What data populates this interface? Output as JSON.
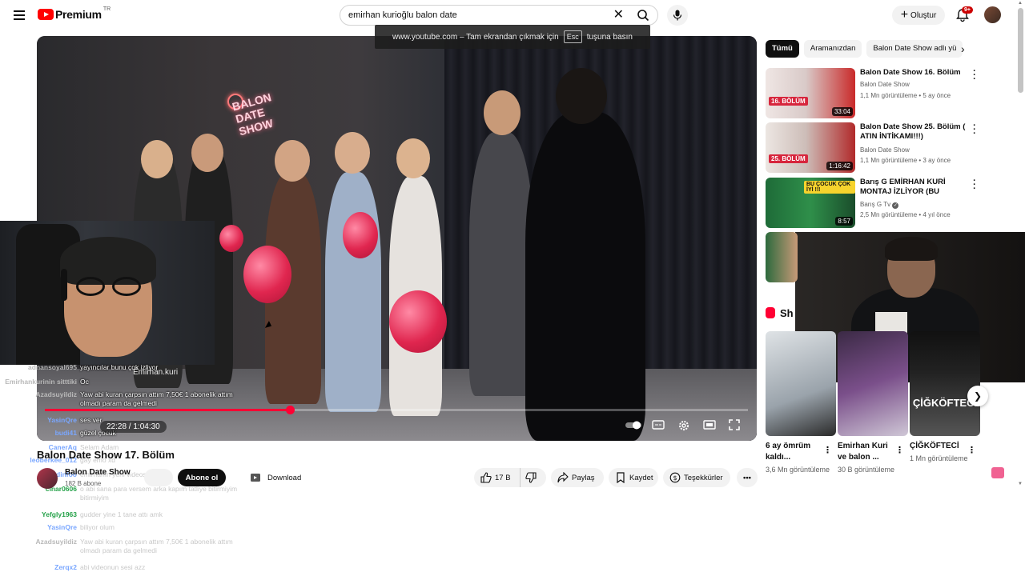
{
  "header": {
    "logo_text": "Premium",
    "logo_region": "TR",
    "search_value": "emirhan kurioğlu balon date",
    "create_label": "Oluştur",
    "notification_count": "9+"
  },
  "fullscreen_tooltip": {
    "text_before": "www.youtube.com – Tam ekrandan çıkmak için",
    "key": "Esc",
    "text_after": "tuşuna basın"
  },
  "player": {
    "current_time": "22:28",
    "duration": "1:04:30",
    "time_separator": " / ",
    "progress_fraction": 0.348,
    "watermark": "Emirhan.kuri",
    "neon_sign": "BALON DATE SHOW"
  },
  "video": {
    "title": "Balon Date Show 17. Bölüm",
    "channel": "Balon Date Show",
    "subscribers": "182 B abone",
    "subscribe_label": "Abone ol",
    "download_label": "Download",
    "likes": "17 B",
    "share_label": "Paylaş",
    "save_label": "Kaydet",
    "thanks_label": "Teşekkürler"
  },
  "chat": [
    {
      "user": "adnansoyal695",
      "msg": "yayıncılar bunu çok izliyor",
      "color": "#b9b9b9",
      "faded": false
    },
    {
      "user": "Emirhankurinin sitttiki",
      "msg": "Oc",
      "color": "#b9b9b9",
      "faded": false
    },
    {
      "user": "Azadsuyildiz",
      "msg": "Yaw abi kuran çarpsın attım 7,50€ 1 abonelik attım olmadı param da gelmedi",
      "color": "#b9b9b9",
      "faded": false
    },
    {
      "user": "YasinQre",
      "msg": "ses ver",
      "color": "#7aa7ff",
      "faded": false
    },
    {
      "user": "budi41",
      "msg": "güzel çocuk",
      "color": "#7aa7ff",
      "faded": false
    },
    {
      "user": "CanerAq",
      "msg": "Selam Adam",
      "color": "#7aa7ff",
      "faded": true
    },
    {
      "user": "leoberkee_012",
      "msg": "gay emo xd",
      "color": "#7aa7ff",
      "faded": true
    },
    {
      "user": "Bedinfoo",
      "msg": "emirhanın yeni videosu izlendi",
      "color": "#7aa7ff",
      "faded": true
    },
    {
      "user": "cinar0606",
      "msg": "o abi sana para versem arka kapım tatliye bitirmiyim bitirmiyim",
      "color": "#24a148",
      "faded": true
    },
    {
      "user": "Yefgly1963",
      "msg": "gudder yine 1 tane attı amk",
      "color": "#24a148",
      "faded": true
    },
    {
      "user": "YasinQre",
      "msg": "biliyor olum",
      "color": "#7aa7ff",
      "faded": true
    },
    {
      "user": "Azadsuyildiz",
      "msg": "Yaw abi kuran çarpsın attım 7,50€ 1 abonelik attım olmadı param da gelmedi",
      "color": "#b9b9b9",
      "faded": true
    },
    {
      "user": "Zerqx2",
      "msg": "abi videonun sesi azz",
      "color": "#7aa7ff",
      "faded": true
    }
  ],
  "chips": [
    {
      "label": "Tümü",
      "active": true
    },
    {
      "label": "Aramanızdan",
      "active": false
    },
    {
      "label": "Balon Date Show adlı yü",
      "active": false
    }
  ],
  "recommendations": [
    {
      "title": "Balon Date Show 16. Bölüm",
      "channel": "Balon Date Show",
      "meta": "1,1 Mn görüntüleme • 5 ay önce",
      "duration": "33:04",
      "badge": "16. BÖLÜM"
    },
    {
      "title": "Balon Date Show 25. Bölüm ( ATIN İNTİKAMI!!!)",
      "channel": "Balon Date Show",
      "meta": "1,1 Mn görüntüleme • 3 ay önce",
      "duration": "1:16:42",
      "badge": "25. BÖLÜM"
    },
    {
      "title": "Barış G EMİRHAN KURİ MONTAJ İZLİYOR (BU ÇOCUK ...",
      "channel": "Barış G Tv",
      "meta": "2,5 Mn görüntüleme • 4 yıl önce",
      "duration": "8:57",
      "badge": "BU ÇOCUK ÇOK İYİ !!!"
    }
  ],
  "shorts": {
    "heading": "Sh",
    "items": [
      {
        "title": "6 ay ömrüm kaldı...",
        "views": "3,6 Mn görüntüleme"
      },
      {
        "title": "Emirhan Kuri ve balon ...",
        "views": "30 B görüntüleme"
      },
      {
        "title": "ÇİĞKÖFTECİ",
        "views": "1 Mn görüntüleme",
        "thumb_text": "ÇİĞKÖFTECİ"
      }
    ]
  }
}
